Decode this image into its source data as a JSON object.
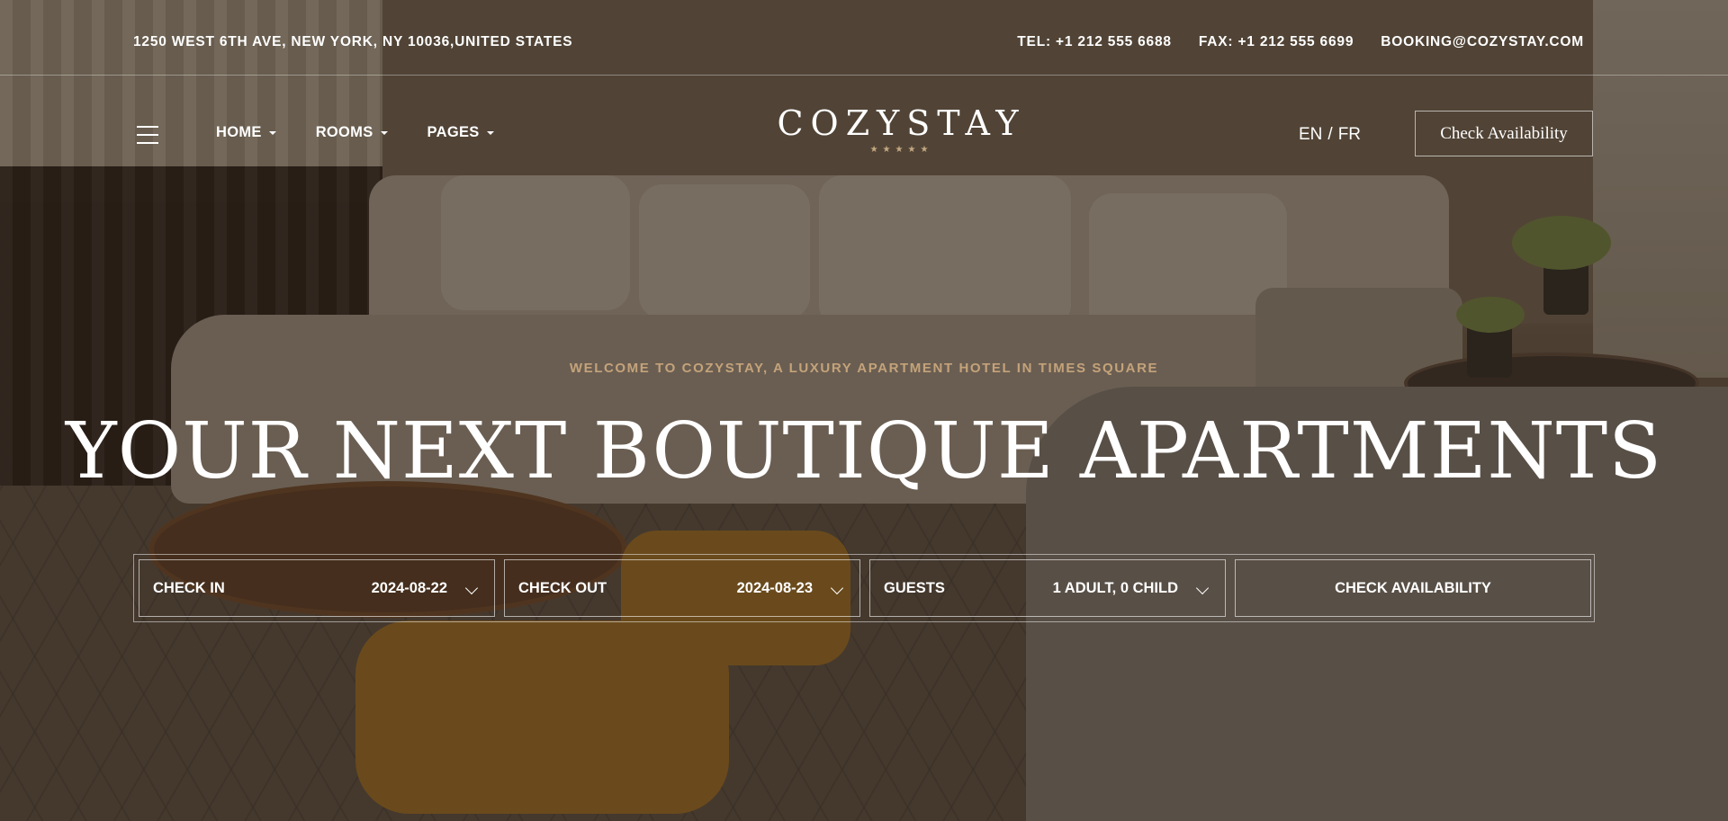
{
  "topbar": {
    "address": "1250 WEST 6TH AVE, NEW YORK, NY 10036,UNITED STATES",
    "tel": "TEL: +1 212 555 6688",
    "fax": "FAX: +1 212 555 6699",
    "email": "BOOKING@COZYSTAY.COM"
  },
  "nav": {
    "items": [
      {
        "label": "HOME"
      },
      {
        "label": "ROOMS"
      },
      {
        "label": "PAGES"
      }
    ]
  },
  "logo": {
    "text": "COZYSTAY",
    "stars": "★★★★★"
  },
  "lang": {
    "en": "EN",
    "sep": "/",
    "fr": "FR"
  },
  "header_button": "Check Availability",
  "hero": {
    "welcome": "WELCOME TO COZYSTAY, A LUXURY APARTMENT HOTEL IN TIMES SQUARE",
    "title": "YOUR NEXT BOUTIQUE APARTMENTS"
  },
  "booking": {
    "check_in": {
      "label": "CHECK IN",
      "value": "2024-08-22"
    },
    "check_out": {
      "label": "CHECK OUT",
      "value": "2024-08-23"
    },
    "guests": {
      "label": "GUESTS",
      "value": "1 ADULT, 0 CHILD"
    },
    "submit": "CHECK AVAILABILITY"
  }
}
